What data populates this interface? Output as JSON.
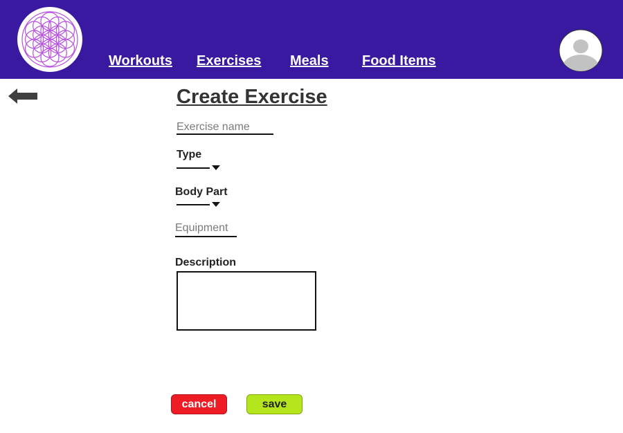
{
  "header": {
    "bg_color": "#39199f",
    "logo_icon": "flower-of-life-icon",
    "nav": [
      {
        "label": "Workouts"
      },
      {
        "label": "Exercises"
      },
      {
        "label": "Meals"
      },
      {
        "label": "Food Items"
      }
    ],
    "avatar_icon": "user-avatar-icon"
  },
  "back_icon": "back-arrow-icon",
  "page": {
    "title": "Create Exercise"
  },
  "form": {
    "exercise_name": {
      "placeholder": "Exercise name",
      "value": ""
    },
    "type": {
      "label": "Type",
      "selected": ""
    },
    "body_part": {
      "label": "Body Part",
      "selected": ""
    },
    "equipment": {
      "placeholder": "Equipment",
      "value": ""
    },
    "description": {
      "label": "Description",
      "value": ""
    }
  },
  "actions": {
    "cancel": {
      "label": "cancel",
      "color": "#ee1c25"
    },
    "save": {
      "label": "save",
      "color": "#b5e61d"
    }
  }
}
